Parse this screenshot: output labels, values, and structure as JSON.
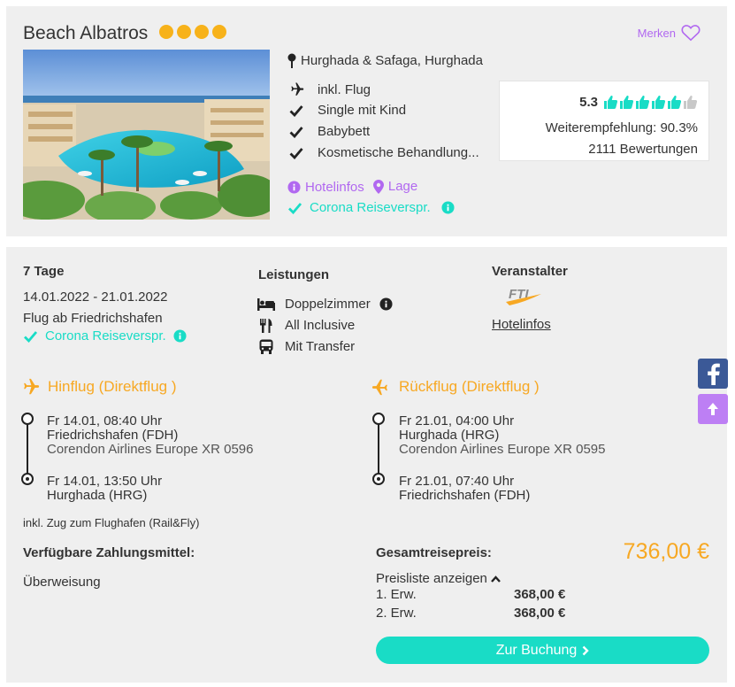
{
  "colors": {
    "star": "#f7b21a",
    "purple": "#b168f0",
    "teal": "#19dcc6",
    "orange": "#f7a823",
    "facebook": "#3b5997",
    "scroll_top": "#bd7ff4",
    "thumb_gray": "#c8c8c8"
  },
  "hotel": {
    "name": "Beach Albatros",
    "stars": 4,
    "merken_label": "Merken",
    "image_alt": "Hotelanlage mit Pool und Palmen",
    "location": "Hurghada & Safaga, Hurghada",
    "features": [
      {
        "icon": "plane-icon",
        "label": "inkl. Flug"
      },
      {
        "icon": "check-icon",
        "label": "Single mit Kind"
      },
      {
        "icon": "check-icon",
        "label": "Babybett"
      },
      {
        "icon": "check-icon",
        "label": "Kosmetische Behandlung..."
      }
    ],
    "rating": {
      "score": "5.3",
      "thumbs_filled": 5,
      "thumbs_total": 6,
      "recommendation": "Weiterempfehlung: 90.3%",
      "reviews": "2111 Bewertungen"
    },
    "links": {
      "hotelinfos": "Hotelinfos",
      "lage": "Lage",
      "corona": "Corona Reiseverspr."
    }
  },
  "trip": {
    "duration": "7 Tage",
    "dates": "14.01.2022 - 21.01.2022",
    "departure": "Flug ab Friedrichshafen",
    "corona": "Corona Reiseverspr."
  },
  "services": {
    "heading": "Leistungen",
    "items": [
      {
        "icon": "bed-icon",
        "label": "Doppelzimmer"
      },
      {
        "icon": "cutlery-icon",
        "label": "All Inclusive"
      },
      {
        "icon": "bus-icon",
        "label": "Mit Transfer"
      }
    ]
  },
  "operator": {
    "heading": "Veranstalter",
    "logo_text": "FTI",
    "link": "Hotelinfos"
  },
  "outbound": {
    "title": "Hinflug (Direktflug )",
    "dep_time": "Fr 14.01, 08:40 Uhr",
    "dep_airport": "Friedrichshafen (FDH)",
    "airline": "Corendon Airlines Europe XR 0596",
    "arr_time": "Fr 14.01, 13:50 Uhr",
    "arr_airport": "Hurghada (HRG)"
  },
  "return": {
    "title": "Rückflug (Direktflug )",
    "dep_time": "Fr 21.01, 04:00 Uhr",
    "dep_airport": "Hurghada (HRG)",
    "airline": "Corendon Airlines Europe XR 0595",
    "arr_time": "Fr 21.01, 07:40 Uhr",
    "arr_airport": "Friedrichshafen (FDH)"
  },
  "rail_note": "inkl. Zug zum Flughafen (Rail&Fly)",
  "payment": {
    "heading": "Verfügbare Zahlungsmittel:",
    "method": "Überweisung"
  },
  "price": {
    "heading": "Gesamtreisepreis:",
    "total": "736,00 €",
    "toggle": "Preisliste anzeigen",
    "rows": [
      {
        "label": "1. Erw.",
        "value": "368,00 €"
      },
      {
        "label": "2. Erw.",
        "value": "368,00 €"
      }
    ],
    "book": "Zur Buchung"
  }
}
